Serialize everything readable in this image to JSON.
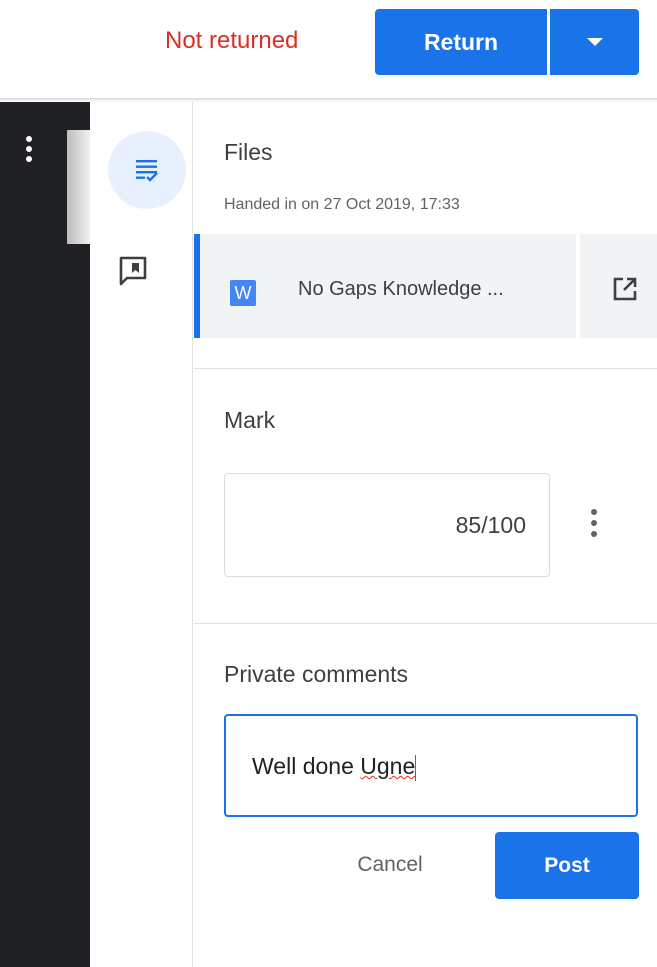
{
  "header": {
    "status": "Not returned",
    "return_label": "Return",
    "return_menu_icon": "caret-down-icon"
  },
  "sidebar": {
    "items": [
      {
        "icon": "assignment-list-icon",
        "active": true
      },
      {
        "icon": "comment-icon",
        "active": false
      }
    ]
  },
  "files": {
    "heading": "Files",
    "handed_in": "Handed in on 27 Oct 2019, 17:33",
    "items": [
      {
        "type_badge": "W",
        "name": "No Gaps Knowledge ...",
        "open_icon": "open-in-new-icon"
      }
    ]
  },
  "mark": {
    "heading": "Mark",
    "value": "85/100"
  },
  "comments": {
    "heading": "Private comments",
    "draft_prefix": "Well done ",
    "draft_misspelled": "Ugne",
    "cancel_label": "Cancel",
    "post_label": "Post"
  },
  "colors": {
    "accent": "#1a73e8",
    "status_red": "#d93025",
    "dark_strip": "#202124"
  }
}
